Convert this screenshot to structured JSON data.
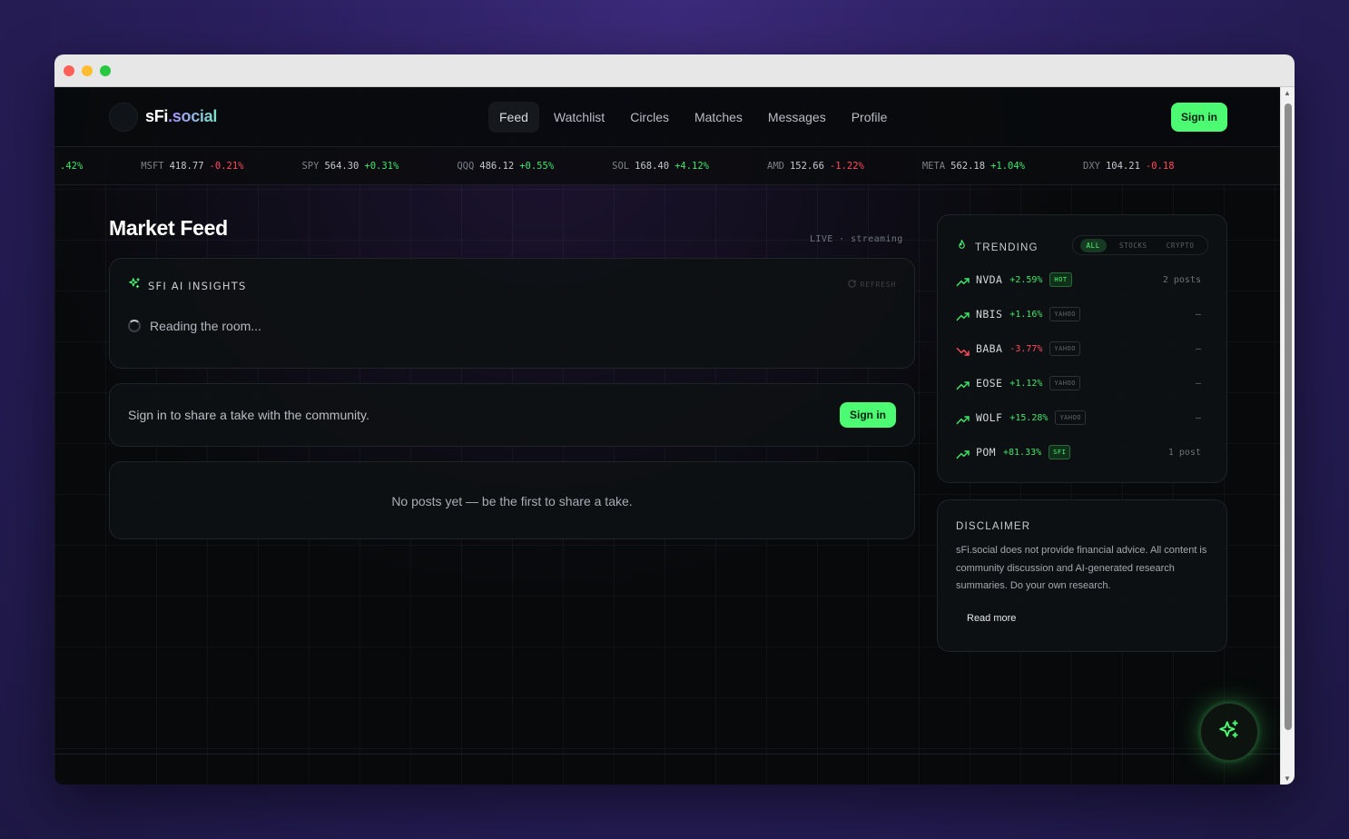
{
  "brand": {
    "name_main": "sFi",
    "name_suffix": ".social"
  },
  "nav": {
    "items": [
      {
        "label": "Feed",
        "active": true
      },
      {
        "label": "Watchlist",
        "active": false
      },
      {
        "label": "Circles",
        "active": false
      },
      {
        "label": "Matches",
        "active": false
      },
      {
        "label": "Messages",
        "active": false
      },
      {
        "label": "Profile",
        "active": false
      }
    ],
    "signin_label": "Sign in"
  },
  "ticker": [
    {
      "sym": "",
      "price": "",
      "change": ".42%",
      "dir": "up"
    },
    {
      "sym": "MSFT",
      "price": "418.77",
      "change": "-0.21%",
      "dir": "down"
    },
    {
      "sym": "SPY",
      "price": "564.30",
      "change": "+0.31%",
      "dir": "up"
    },
    {
      "sym": "QQQ",
      "price": "486.12",
      "change": "+0.55%",
      "dir": "up"
    },
    {
      "sym": "SOL",
      "price": "168.40",
      "change": "+4.12%",
      "dir": "up"
    },
    {
      "sym": "AMD",
      "price": "152.66",
      "change": "-1.22%",
      "dir": "down"
    },
    {
      "sym": "META",
      "price": "562.18",
      "change": "+1.04%",
      "dir": "up"
    },
    {
      "sym": "DXY",
      "price": "104.21",
      "change": "-0.18",
      "dir": "down"
    }
  ],
  "feed": {
    "title": "Market Feed",
    "live_status": "LIVE · streaming",
    "insights": {
      "title": "SFI AI INSIGHTS",
      "refresh_label": "REFRESH",
      "loading_text": "Reading the room..."
    },
    "signin_prompt": {
      "text": "Sign in to share a take with the community.",
      "button_label": "Sign in"
    },
    "empty_text": "No posts yet — be the first to share a take."
  },
  "trending": {
    "title": "TRENDING",
    "filters": [
      {
        "label": "ALL",
        "active": true
      },
      {
        "label": "STOCKS",
        "active": false
      },
      {
        "label": "CRYPTO",
        "active": false
      }
    ],
    "items": [
      {
        "sym": "NVDA",
        "change": "+2.59%",
        "dir": "up",
        "badge": "HOT",
        "badge_style": "green",
        "count": "2 posts"
      },
      {
        "sym": "NBIS",
        "change": "+1.16%",
        "dir": "up",
        "badge": "YAHOO",
        "badge_style": "gray",
        "count": "—"
      },
      {
        "sym": "BABA",
        "change": "-3.77%",
        "dir": "down",
        "badge": "YAHOO",
        "badge_style": "gray",
        "count": "—"
      },
      {
        "sym": "EOSE",
        "change": "+1.12%",
        "dir": "up",
        "badge": "YAHOO",
        "badge_style": "gray",
        "count": "—"
      },
      {
        "sym": "WOLF",
        "change": "+15.28%",
        "dir": "up",
        "badge": "YAHOO",
        "badge_style": "gray",
        "count": "—"
      },
      {
        "sym": "POM",
        "change": "+81.33%",
        "dir": "up",
        "badge": "SFI",
        "badge_style": "green",
        "count": "1 post"
      }
    ]
  },
  "disclaimer": {
    "title": "DISCLAIMER",
    "body": "sFi.social does not provide financial advice. All content is community discussion and AI-generated research summaries. Do your own research.",
    "read_more": "Read more"
  },
  "colors": {
    "accent": "#4cfb72",
    "up": "#3ee66b",
    "down": "#ff4b5c",
    "background": "#07090a"
  },
  "icons": {
    "insights": "sparkles-icon",
    "trending": "flame-icon",
    "refresh": "refresh-icon",
    "fab": "sparkles-icon"
  }
}
